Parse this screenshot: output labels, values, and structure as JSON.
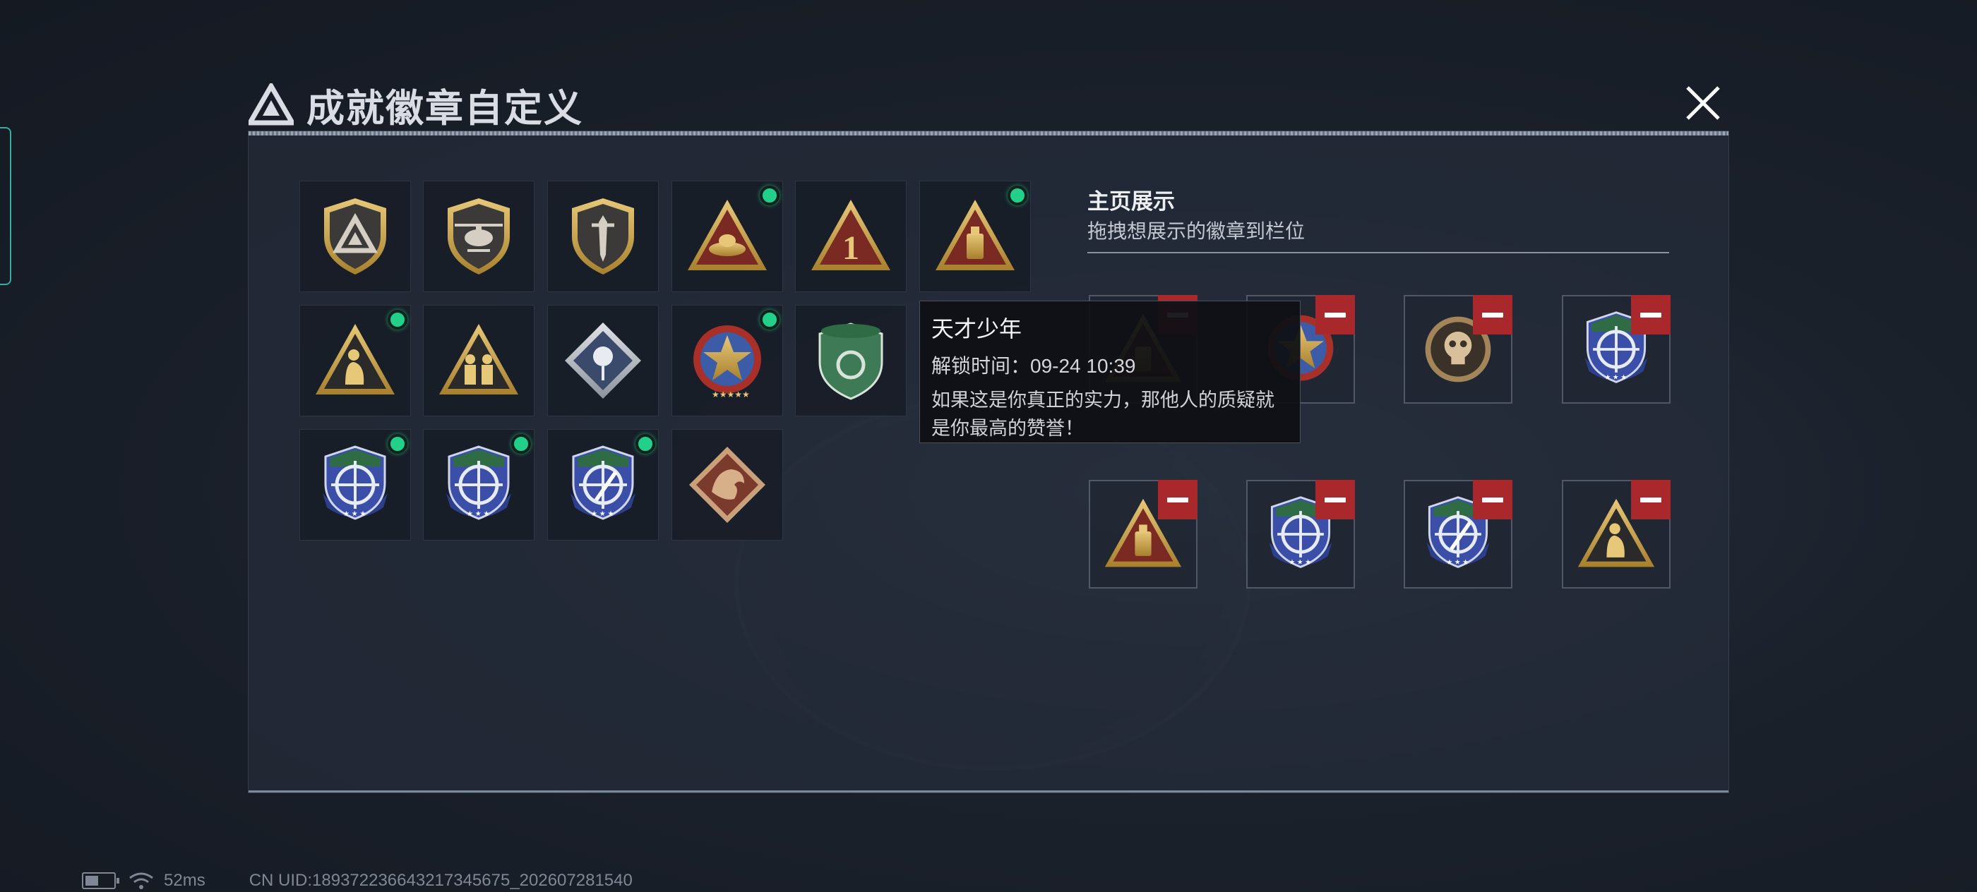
{
  "header": {
    "title": "成就徽章自定义"
  },
  "inventory": {
    "badges": [
      {
        "icon": "triangle-logo-shield-badge-icon",
        "new": false
      },
      {
        "icon": "helicopter-shield-badge-icon",
        "new": false
      },
      {
        "icon": "dagger-shield-badge-icon",
        "new": false
      },
      {
        "icon": "bird-nest-triangle-badge-icon",
        "new": true
      },
      {
        "icon": "number-one-triangle-badge-icon",
        "new": false
      },
      {
        "icon": "bottle-triangle-badge-icon",
        "new": true
      },
      {
        "icon": "sitting-figure-triangle-badge-icon",
        "new": true
      },
      {
        "icon": "two-figures-triangle-badge-icon",
        "new": false
      },
      {
        "icon": "rose-diamond-badge-icon",
        "new": false
      },
      {
        "icon": "star-medal-badge-icon",
        "new": true
      },
      {
        "icon": "green-shield-badge-icon",
        "new": false
      },
      {
        "icon": "rifle-crosshair-shield-badge-icon",
        "new": true
      },
      {
        "icon": "rifle-crosshair-shield-badge-icon",
        "new": true
      },
      {
        "icon": "knife-crosshair-shield-badge-icon",
        "new": true
      },
      {
        "icon": "dragon-diamond-badge-icon",
        "new": false
      }
    ]
  },
  "showcase": {
    "title": "主页展示",
    "subtitle": "拖拽想展示的徽章到栏位",
    "slots": [
      {
        "icon": "bottle-triangle-badge-icon"
      },
      {
        "icon": "star-medal-badge-icon"
      },
      {
        "icon": "skull-coin-badge-icon"
      },
      {
        "icon": "rifle-crosshair-shield-badge-icon"
      },
      {
        "icon": "bottle-triangle-badge-icon"
      },
      {
        "icon": "rifle-crosshair-shield-badge-icon"
      },
      {
        "icon": "knife-crosshair-shield-badge-icon"
      },
      {
        "icon": "sitting-figure-triangle-badge-icon"
      }
    ]
  },
  "tooltip": {
    "name": "天才少年",
    "unlock_time": "解锁时间：09-24 10:39",
    "description": "如果这是你真正的实力，那他人的质疑就是你最高的赞誉！"
  },
  "status_bar": {
    "ping": "52ms",
    "uid": "CN UID:189372236643217345675_202607281540"
  },
  "colors": {
    "new_dot": "#22d08a",
    "remove_button": "#a8282b",
    "gold": "#c9a24a",
    "triangle_red": "#7a2a22"
  }
}
